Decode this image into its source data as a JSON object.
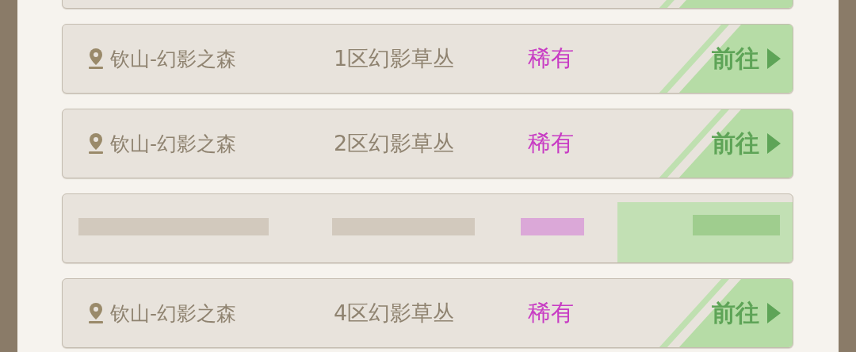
{
  "rows": [
    {
      "kind": "cut"
    },
    {
      "kind": "entry",
      "location": "钦山-幻影之森",
      "area": "1区幻影草丛",
      "rarity": "稀有",
      "action": "前往"
    },
    {
      "kind": "entry",
      "location": "钦山-幻影之森",
      "area": "2区幻影草丛",
      "rarity": "稀有",
      "action": "前往"
    },
    {
      "kind": "obscured"
    },
    {
      "kind": "entry",
      "location": "钦山-幻影之森",
      "area": "4区幻影草丛",
      "rarity": "稀有",
      "action": "前往"
    }
  ]
}
